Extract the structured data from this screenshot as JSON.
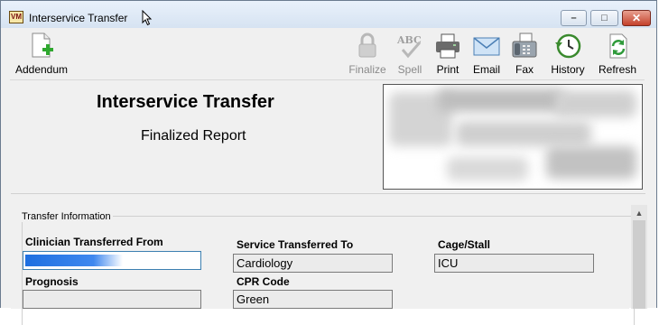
{
  "window": {
    "title": "Interservice Transfer",
    "app_icon_text": "VM",
    "buttons": {
      "minimize": "–",
      "maximize": "□",
      "close": "✕"
    }
  },
  "toolbar": {
    "addendum": {
      "label": "Addendum",
      "icon": "document-add-icon",
      "enabled": true
    },
    "finalize": {
      "label": "Finalize",
      "icon": "lock-icon",
      "enabled": false
    },
    "spell": {
      "label": "Spell",
      "icon": "spellcheck-icon",
      "enabled": false
    },
    "print": {
      "label": "Print",
      "icon": "printer-icon",
      "enabled": true
    },
    "email": {
      "label": "Email",
      "icon": "envelope-icon",
      "enabled": true
    },
    "fax": {
      "label": "Fax",
      "icon": "fax-icon",
      "enabled": true
    },
    "history": {
      "label": "History",
      "icon": "clock-icon",
      "enabled": true
    },
    "refresh": {
      "label": "Refresh",
      "icon": "refresh-icon",
      "enabled": true
    }
  },
  "report": {
    "title": "Interservice Transfer",
    "status": "Finalized Report"
  },
  "transfer_info": {
    "group_label": "Transfer Information",
    "clinician_label": "Clinician Transferred From",
    "clinician_value": "",
    "service_label": "Service Transferred To",
    "service_value": "Cardiology",
    "cage_label": "Cage/Stall",
    "cage_value": "ICU",
    "prognosis_label": "Prognosis",
    "prognosis_value": "",
    "cpr_label": "CPR Code",
    "cpr_value": "Green"
  },
  "colors": {
    "titlebar": "#dce7f5",
    "close_button": "#c4412b",
    "selection": "#1e6fe0",
    "disabled_text": "#8a8a8a"
  }
}
